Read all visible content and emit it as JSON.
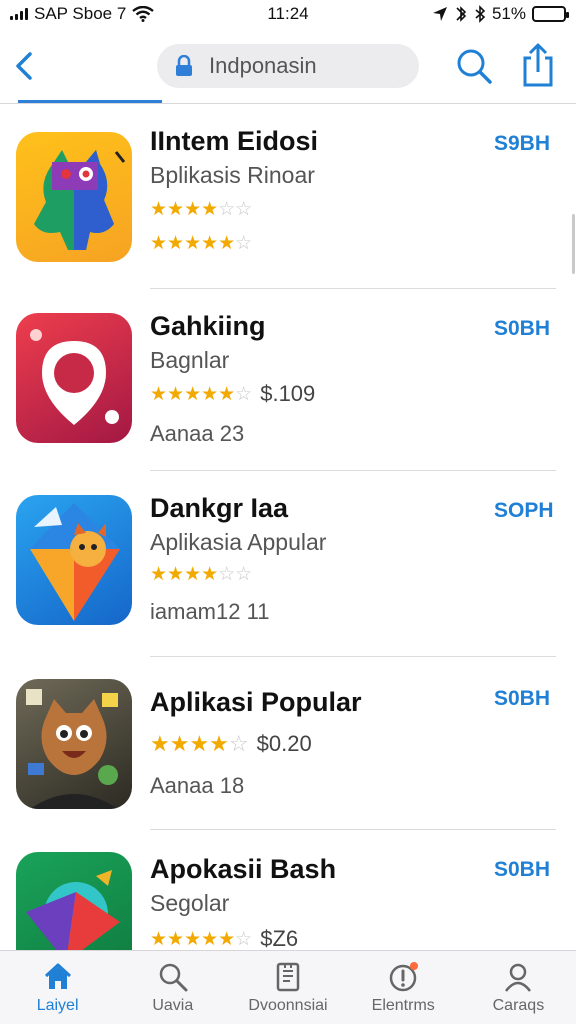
{
  "status_bar": {
    "carrier": "SAP Sboe 7",
    "time": "11:24",
    "battery": "51%",
    "battery_level": 0.51
  },
  "header": {
    "search_text": "Indponasin",
    "icons": [
      "back-chevron-icon",
      "lock-icon",
      "search-icon",
      "share-icon"
    ]
  },
  "apps": [
    {
      "name": "IIntem Eidosi",
      "subtitle": "Bplikasis Rinoar",
      "rating": 3,
      "rating2": 4,
      "price": "",
      "extra": "",
      "get_label": "S9BH"
    },
    {
      "name": "Gahkiing",
      "subtitle": "Bagnlar",
      "rating": 4,
      "price": "$.109",
      "extra": "Aanaa 23",
      "get_label": "S0BH"
    },
    {
      "name": "Dankgr Iaa",
      "subtitle": "Aplikasia Appular",
      "rating": 3,
      "price": "",
      "extra": "iamam12 11",
      "get_label": "SOPH"
    },
    {
      "name": "Aplikasi Popular",
      "subtitle": "",
      "rating": 4,
      "price": "$0.20",
      "extra": "Aanaa 18",
      "get_label": "S0BH"
    },
    {
      "name": "Apokasii Bash",
      "subtitle": "Segolar",
      "rating": 4,
      "price": "$Z6",
      "extra": "",
      "get_label": "S0BH"
    }
  ],
  "tab_bar": [
    {
      "label": "Laiyel",
      "icon": "home-icon",
      "active": true
    },
    {
      "label": "Uavia",
      "icon": "search-icon",
      "active": false
    },
    {
      "label": "Dvoonnsiai",
      "icon": "document-icon",
      "active": false
    },
    {
      "label": "Elentrms",
      "icon": "alert-icon",
      "active": false
    },
    {
      "label": "Caraqs",
      "icon": "person-icon",
      "active": false
    }
  ],
  "colors": {
    "accent": "#1f80d6",
    "star": "#f2a900",
    "badge": "#ff6a3d"
  }
}
